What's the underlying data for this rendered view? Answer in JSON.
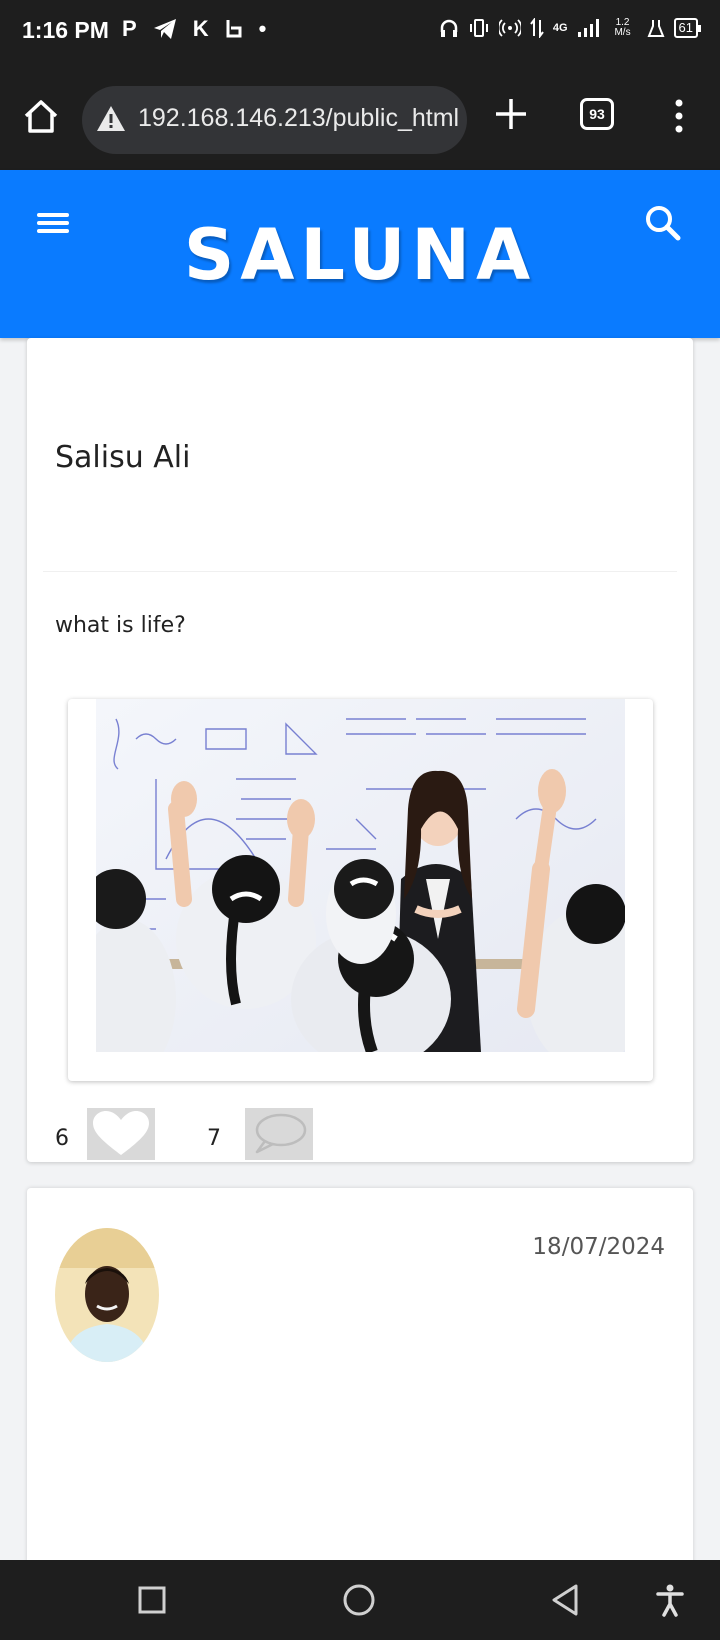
{
  "status_bar": {
    "time": "1:16 PM",
    "left_icons": [
      "P",
      "telegram-icon",
      "K",
      "notification-icon",
      "•"
    ],
    "network": "4G",
    "speed": "1.2 M/s",
    "battery": "61"
  },
  "browser": {
    "url": "192.168.146.213/public_html",
    "tab_count": "93"
  },
  "header": {
    "brand": "SALUNA",
    "color": "#0a7bff"
  },
  "post": {
    "author": "Salisu Ali",
    "text": "what is life?",
    "likes": "6",
    "comments": "7"
  },
  "next_post": {
    "date": "18/07/2024"
  }
}
